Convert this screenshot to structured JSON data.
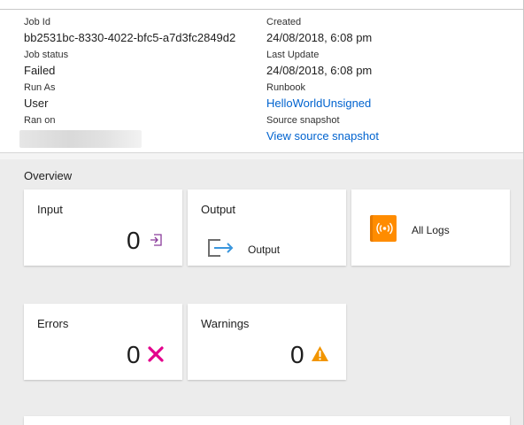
{
  "details": {
    "job_id": {
      "label": "Job Id",
      "value": "bb2531bc-8330-4022-bfc5-a7d3fc2849d2"
    },
    "created": {
      "label": "Created",
      "value": "24/08/2018, 6:08 pm"
    },
    "job_status": {
      "label": "Job status",
      "value": "Failed"
    },
    "last_update": {
      "label": "Last Update",
      "value": "24/08/2018, 6:08 pm"
    },
    "run_as": {
      "label": "Run As",
      "value": "User"
    },
    "runbook": {
      "label": "Runbook",
      "value": "HelloWorldUnsigned"
    },
    "ran_on": {
      "label": "Ran on",
      "value": ""
    },
    "source_snapshot": {
      "label": "Source snapshot",
      "value": "View source snapshot"
    }
  },
  "overview": {
    "title": "Overview",
    "tiles": {
      "input": {
        "title": "Input",
        "count": "0",
        "icon": "input-arrow-icon"
      },
      "output": {
        "title": "Output",
        "label": "Output",
        "icon": "output-arrow-icon"
      },
      "all_logs": {
        "label": "All Logs",
        "icon": "log-stream-icon"
      },
      "errors": {
        "title": "Errors",
        "count": "0",
        "icon": "error-x-icon"
      },
      "warnings": {
        "title": "Warnings",
        "count": "0",
        "icon": "warning-triangle-icon"
      }
    }
  },
  "colors": {
    "link": "#0063cf",
    "error": "#e3008c",
    "warning": "#f29500",
    "logs": "#ff8c00",
    "input_icon": "#8a3c9b",
    "output_icon": "#3a96dd"
  }
}
